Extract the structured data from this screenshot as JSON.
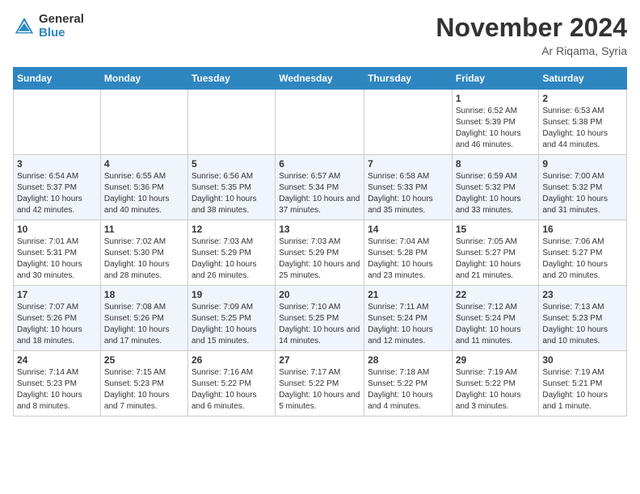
{
  "header": {
    "logo_general": "General",
    "logo_blue": "Blue",
    "month_title": "November 2024",
    "location": "Ar Riqama, Syria"
  },
  "days_of_week": [
    "Sunday",
    "Monday",
    "Tuesday",
    "Wednesday",
    "Thursday",
    "Friday",
    "Saturday"
  ],
  "weeks": [
    [
      {
        "day": "",
        "info": ""
      },
      {
        "day": "",
        "info": ""
      },
      {
        "day": "",
        "info": ""
      },
      {
        "day": "",
        "info": ""
      },
      {
        "day": "",
        "info": ""
      },
      {
        "day": "1",
        "info": "Sunrise: 6:52 AM\nSunset: 5:39 PM\nDaylight: 10 hours and 46 minutes."
      },
      {
        "day": "2",
        "info": "Sunrise: 6:53 AM\nSunset: 5:38 PM\nDaylight: 10 hours and 44 minutes."
      }
    ],
    [
      {
        "day": "3",
        "info": "Sunrise: 6:54 AM\nSunset: 5:37 PM\nDaylight: 10 hours and 42 minutes."
      },
      {
        "day": "4",
        "info": "Sunrise: 6:55 AM\nSunset: 5:36 PM\nDaylight: 10 hours and 40 minutes."
      },
      {
        "day": "5",
        "info": "Sunrise: 6:56 AM\nSunset: 5:35 PM\nDaylight: 10 hours and 38 minutes."
      },
      {
        "day": "6",
        "info": "Sunrise: 6:57 AM\nSunset: 5:34 PM\nDaylight: 10 hours and 37 minutes."
      },
      {
        "day": "7",
        "info": "Sunrise: 6:58 AM\nSunset: 5:33 PM\nDaylight: 10 hours and 35 minutes."
      },
      {
        "day": "8",
        "info": "Sunrise: 6:59 AM\nSunset: 5:32 PM\nDaylight: 10 hours and 33 minutes."
      },
      {
        "day": "9",
        "info": "Sunrise: 7:00 AM\nSunset: 5:32 PM\nDaylight: 10 hours and 31 minutes."
      }
    ],
    [
      {
        "day": "10",
        "info": "Sunrise: 7:01 AM\nSunset: 5:31 PM\nDaylight: 10 hours and 30 minutes."
      },
      {
        "day": "11",
        "info": "Sunrise: 7:02 AM\nSunset: 5:30 PM\nDaylight: 10 hours and 28 minutes."
      },
      {
        "day": "12",
        "info": "Sunrise: 7:03 AM\nSunset: 5:29 PM\nDaylight: 10 hours and 26 minutes."
      },
      {
        "day": "13",
        "info": "Sunrise: 7:03 AM\nSunset: 5:29 PM\nDaylight: 10 hours and 25 minutes."
      },
      {
        "day": "14",
        "info": "Sunrise: 7:04 AM\nSunset: 5:28 PM\nDaylight: 10 hours and 23 minutes."
      },
      {
        "day": "15",
        "info": "Sunrise: 7:05 AM\nSunset: 5:27 PM\nDaylight: 10 hours and 21 minutes."
      },
      {
        "day": "16",
        "info": "Sunrise: 7:06 AM\nSunset: 5:27 PM\nDaylight: 10 hours and 20 minutes."
      }
    ],
    [
      {
        "day": "17",
        "info": "Sunrise: 7:07 AM\nSunset: 5:26 PM\nDaylight: 10 hours and 18 minutes."
      },
      {
        "day": "18",
        "info": "Sunrise: 7:08 AM\nSunset: 5:26 PM\nDaylight: 10 hours and 17 minutes."
      },
      {
        "day": "19",
        "info": "Sunrise: 7:09 AM\nSunset: 5:25 PM\nDaylight: 10 hours and 15 minutes."
      },
      {
        "day": "20",
        "info": "Sunrise: 7:10 AM\nSunset: 5:25 PM\nDaylight: 10 hours and 14 minutes."
      },
      {
        "day": "21",
        "info": "Sunrise: 7:11 AM\nSunset: 5:24 PM\nDaylight: 10 hours and 12 minutes."
      },
      {
        "day": "22",
        "info": "Sunrise: 7:12 AM\nSunset: 5:24 PM\nDaylight: 10 hours and 11 minutes."
      },
      {
        "day": "23",
        "info": "Sunrise: 7:13 AM\nSunset: 5:23 PM\nDaylight: 10 hours and 10 minutes."
      }
    ],
    [
      {
        "day": "24",
        "info": "Sunrise: 7:14 AM\nSunset: 5:23 PM\nDaylight: 10 hours and 8 minutes."
      },
      {
        "day": "25",
        "info": "Sunrise: 7:15 AM\nSunset: 5:23 PM\nDaylight: 10 hours and 7 minutes."
      },
      {
        "day": "26",
        "info": "Sunrise: 7:16 AM\nSunset: 5:22 PM\nDaylight: 10 hours and 6 minutes."
      },
      {
        "day": "27",
        "info": "Sunrise: 7:17 AM\nSunset: 5:22 PM\nDaylight: 10 hours and 5 minutes."
      },
      {
        "day": "28",
        "info": "Sunrise: 7:18 AM\nSunset: 5:22 PM\nDaylight: 10 hours and 4 minutes."
      },
      {
        "day": "29",
        "info": "Sunrise: 7:19 AM\nSunset: 5:22 PM\nDaylight: 10 hours and 3 minutes."
      },
      {
        "day": "30",
        "info": "Sunrise: 7:19 AM\nSunset: 5:21 PM\nDaylight: 10 hours and 1 minute."
      }
    ]
  ]
}
